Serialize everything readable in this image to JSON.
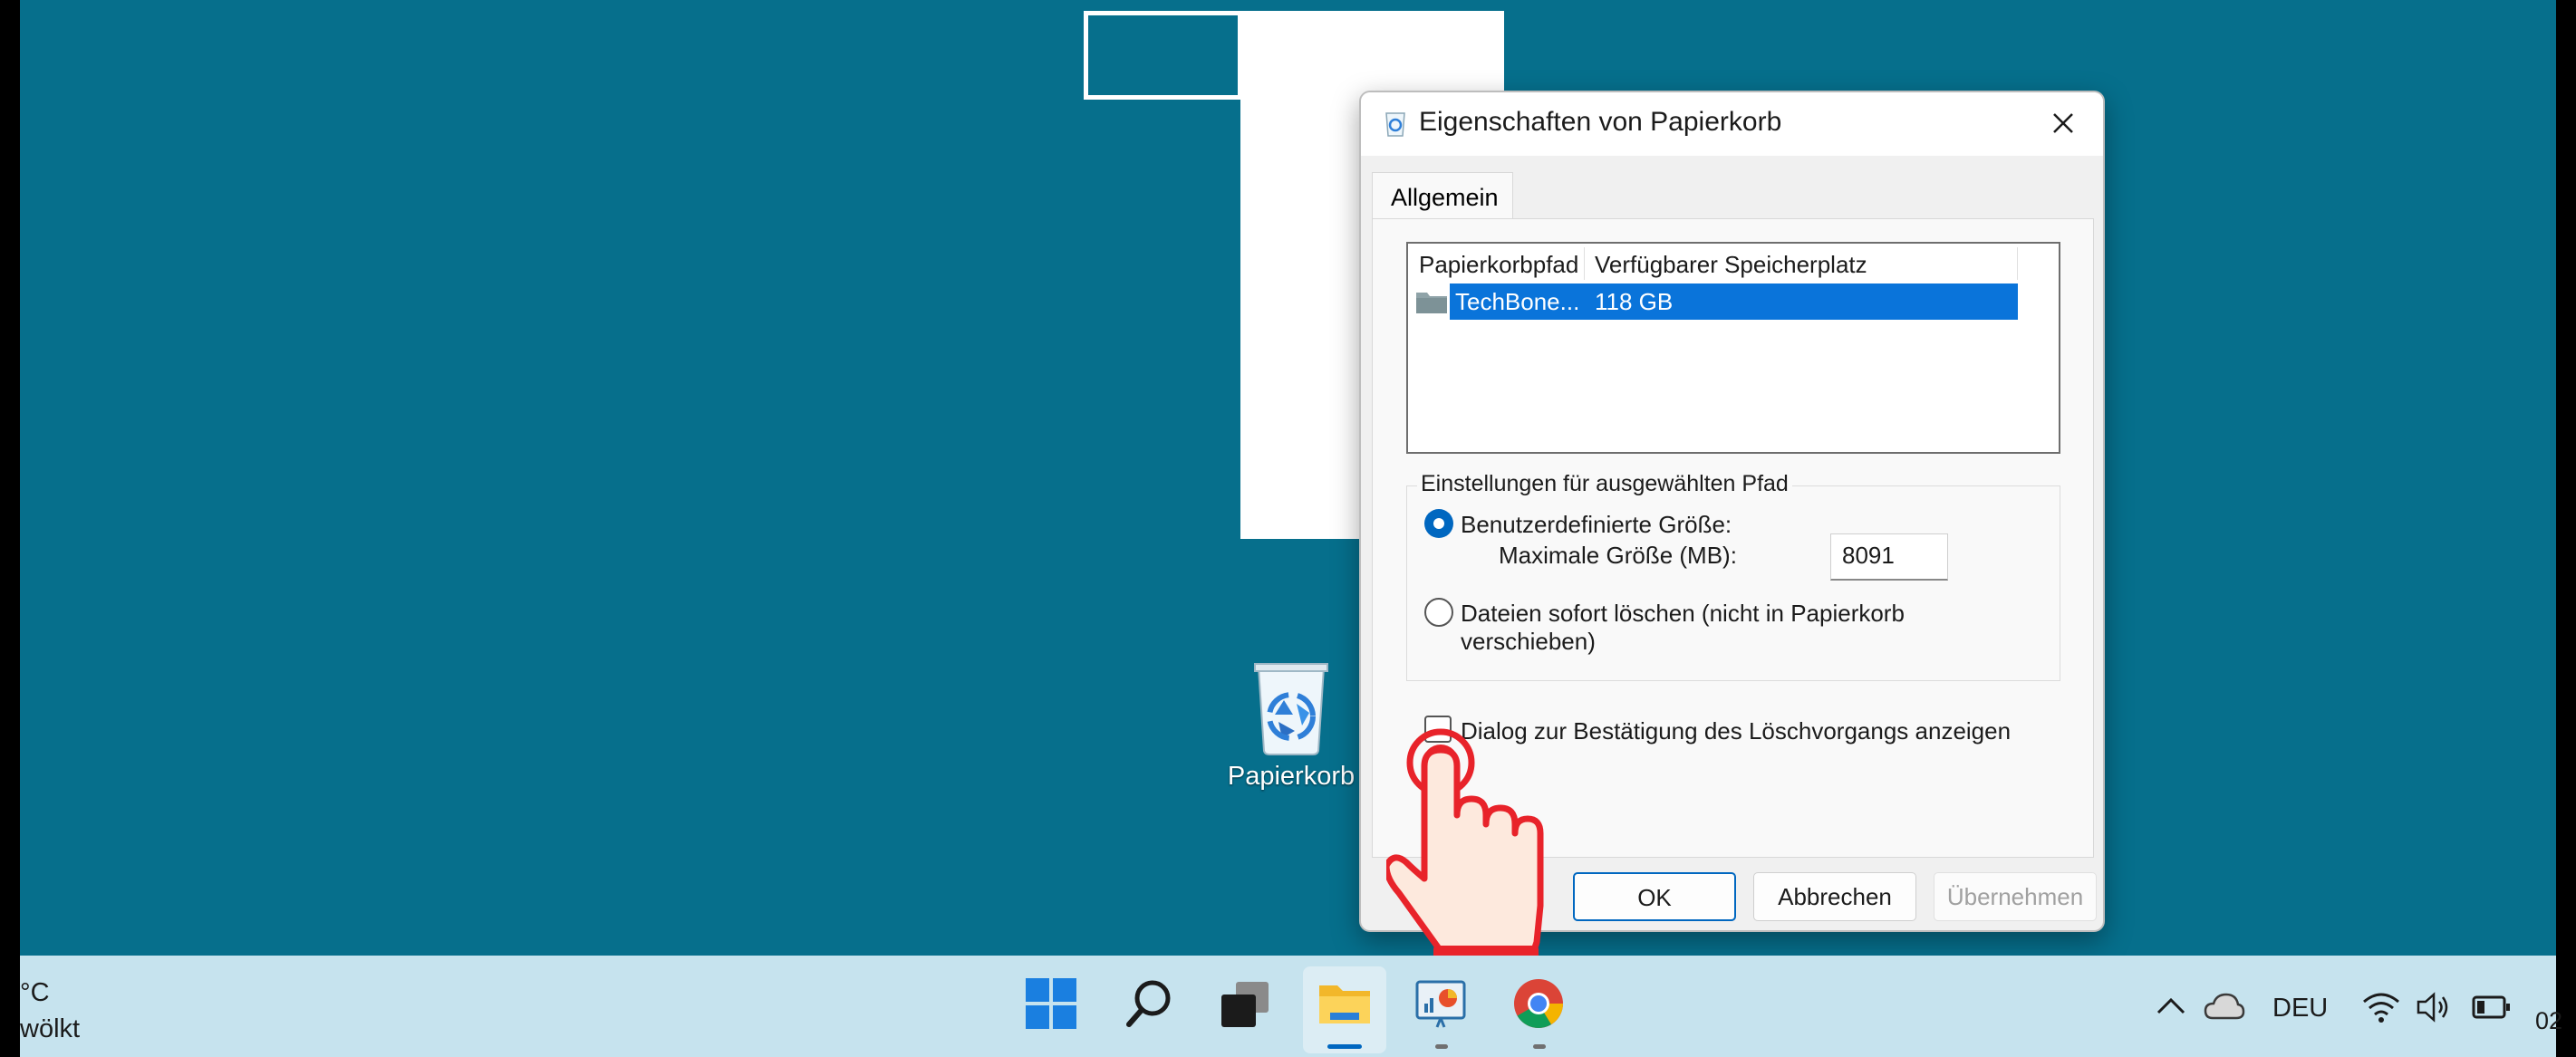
{
  "desktop": {
    "recycle_bin_label": "Papierkorb"
  },
  "dialog": {
    "title": "Eigenschaften von Papierkorb",
    "tab": "Allgemein",
    "list": {
      "col_path": "Papierkorbpfad",
      "col_space": "Verfügbarer Speicherplatz",
      "rows": [
        {
          "path": "TechBone...",
          "space": "118 GB"
        }
      ]
    },
    "group_title": "Einstellungen für ausgewählten Pfad",
    "custom_size_label": "Benutzerdefinierte Größe:",
    "max_size_label": "Maximale Größe (MB):",
    "max_size_value": "8091",
    "delete_immediately_line1": "Dateien sofort löschen (nicht in Papierkorb",
    "delete_immediately_line2": "verschieben)",
    "confirm_dialog_label": "Dialog zur Bestätigung des Löschvorgangs anzeigen",
    "custom_size_selected": true,
    "confirm_checked": false,
    "buttons": {
      "ok": "OK",
      "cancel": "Abbrechen",
      "apply": "Übernehmen"
    }
  },
  "taskbar": {
    "weather_line1": "°C",
    "weather_line2": "wölkt",
    "language": "DEU",
    "clock_partial": "02",
    "icons": [
      "windows-start-icon",
      "search-icon",
      "task-view-icon",
      "file-explorer-icon",
      "presentation-app-icon",
      "chrome-icon"
    ]
  },
  "colors": {
    "desktop": "#066f8c",
    "taskbar": "#c6e3ee",
    "selection": "#0a74da",
    "accent": "#0067c0"
  }
}
